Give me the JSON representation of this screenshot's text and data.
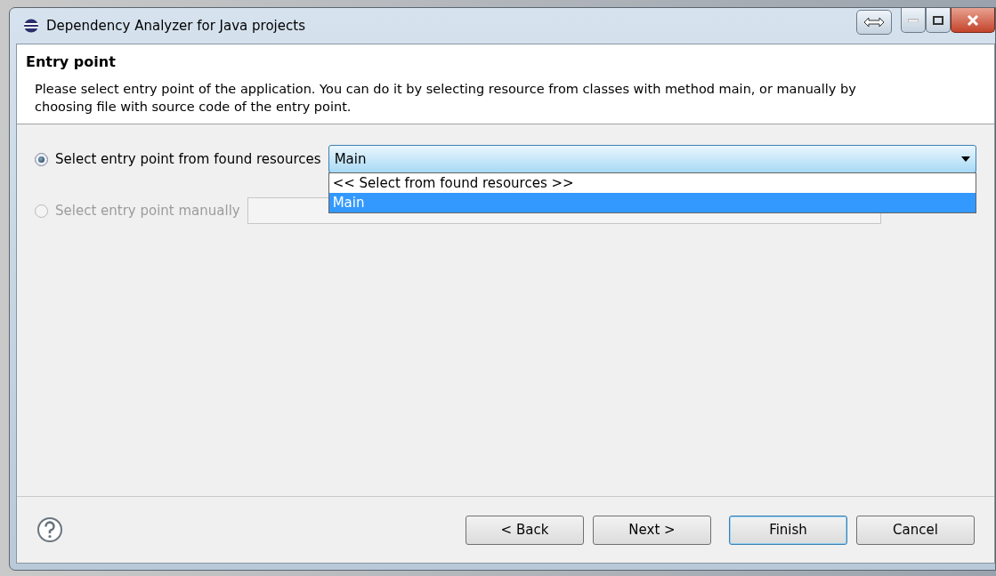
{
  "window": {
    "title": "Dependency Analyzer for Java projects"
  },
  "header": {
    "title": "Entry point",
    "description": "Please select entry point of the application. You can do it by selecting resource from classes with method main, or manually by choosing file with source code of the entry point."
  },
  "options": [
    {
      "kind": "combo",
      "label": "Select entry point from found resources",
      "selected": true,
      "disabled": false,
      "value": "Main",
      "expanded": true,
      "items": [
        {
          "label": "<< Select from found resources >>",
          "selected": false
        },
        {
          "label": "Main",
          "selected": true
        }
      ]
    },
    {
      "kind": "text",
      "label": "Select entry point manually",
      "selected": false,
      "disabled": true
    }
  ],
  "buttons": [
    {
      "label": "< Back",
      "default": false
    },
    {
      "label": "Next >",
      "default": false
    },
    {
      "label": "Finish",
      "default": true
    },
    {
      "label": "Cancel",
      "default": false
    }
  ]
}
